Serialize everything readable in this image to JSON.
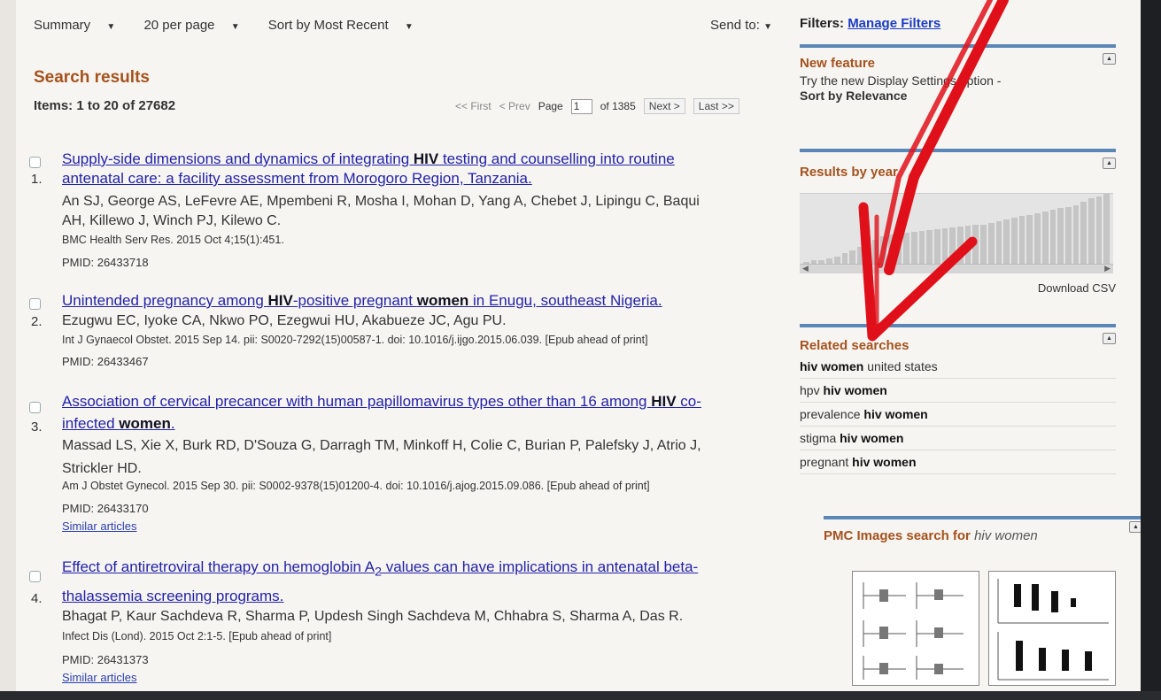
{
  "toolbar": {
    "format": "Summary",
    "per_page": "20 per page",
    "sort": "Sort by Most Recent",
    "send_to": "Send to:"
  },
  "filters": {
    "label": "Filters:",
    "manage": "Manage Filters"
  },
  "results_header": {
    "title": "Search results",
    "items": "Items: 1 to 20 of 27682"
  },
  "pager": {
    "first": "<< First",
    "prev": "< Prev",
    "page_label": "Page",
    "page_value": "1",
    "of_pages": "of 1385",
    "next": "Next >",
    "last": "Last >>"
  },
  "results": [
    {
      "num": "1.",
      "title_line1": [
        "Supply-side dimensions and dynamics of integrating ",
        "HIV",
        " testing and counselling into routine"
      ],
      "title_line2": "antenatal care: a facility assessment from Morogoro Region, Tanzania.",
      "authors_line1": "An SJ, George AS, LeFevre AE, Mpembeni R, Mosha I, Mohan D, Yang A, Chebet J, Lipingu C, Baqui",
      "authors_line2": "AH, Killewo J, Winch PJ, Kilewo C.",
      "journal": "BMC Health Serv Res. 2015 Oct 4;15(1):451.",
      "pmid": "PMID: 26433718"
    },
    {
      "num": "2.",
      "title_parts": [
        "Unintended pregnancy among ",
        "HIV",
        "-positive pregnant ",
        "women",
        " in Enugu, southeast Nigeria."
      ],
      "authors_line1": "Ezugwu EC, Iyoke CA, Nkwo PO, Ezegwui HU, Akabueze JC, Agu PU.",
      "journal": "Int J Gynaecol Obstet. 2015 Sep 14. pii: S0020-7292(15)00587-1. doi: 10.1016/j.ijgo.2015.06.039. [Epub ahead of print]",
      "pmid": "PMID: 26433467"
    },
    {
      "num": "3.",
      "title_line1": [
        "Association of cervical precancer with human papillomavirus types other than 16 among ",
        "HIV",
        " co-"
      ],
      "title_line2": [
        "infected ",
        "women",
        "."
      ],
      "authors_line1": "Massad LS, Xie X, Burk RD, D'Souza G, Darragh TM, Minkoff H, Colie C, Burian P, Palefsky J, Atrio J,",
      "authors_line2": "Strickler HD.",
      "journal": "Am J Obstet Gynecol. 2015 Sep 30. pii: S0002-9378(15)01200-4. doi: 10.1016/j.ajog.2015.09.086. [Epub ahead of print]",
      "pmid": "PMID: 26433170",
      "similar": "Similar articles"
    },
    {
      "num": "4.",
      "title_line1": [
        "Effect of antiretroviral therapy on hemoglobin A",
        "2",
        " values can have implications in antenatal beta-"
      ],
      "title_line2": "thalassemia screening programs.",
      "authors_line1": "Bhagat P, Kaur Sachdeva R, Sharma P, Updesh Singh Sachdeva M, Chhabra S, Sharma A, Das R.",
      "journal": "Infect Dis (Lond). 2015 Oct 2:1-5. [Epub ahead of print]",
      "pmid": "PMID: 26431373",
      "similar": "Similar articles"
    }
  ],
  "sidebar": {
    "new_feature": {
      "title": "New feature",
      "text": "Try the new Display Settings option -",
      "link": "Sort by Relevance"
    },
    "results_by_year": {
      "title": "Results by year",
      "download": "Download CSV"
    },
    "related": {
      "title": "Related searches",
      "items": [
        [
          "",
          "hiv women",
          " united states"
        ],
        [
          "hpv ",
          "hiv women",
          ""
        ],
        [
          "prevalence ",
          "hiv women",
          ""
        ],
        [
          "stigma ",
          "hiv women",
          ""
        ],
        [
          "pregnant ",
          "hiv women",
          ""
        ]
      ]
    },
    "pmc": {
      "title": "PMC Images search for ",
      "query": "hiv women"
    }
  },
  "colors": {
    "heading_orange": "#a5521e",
    "link_blue": "#2222aa",
    "sidebar_bar": "#5b86b8",
    "annotation_red": "#e0101a"
  },
  "chart_data": {
    "type": "bar",
    "title": "Results by year",
    "values": [
      3,
      5,
      6,
      8,
      10,
      14,
      18,
      22,
      27,
      31,
      35,
      37,
      39,
      40,
      41,
      42,
      43,
      44,
      45,
      46,
      47,
      48,
      49,
      50,
      52,
      54,
      56,
      58,
      60,
      62,
      64,
      66,
      68,
      70,
      72,
      74,
      78,
      82,
      85,
      88
    ]
  }
}
